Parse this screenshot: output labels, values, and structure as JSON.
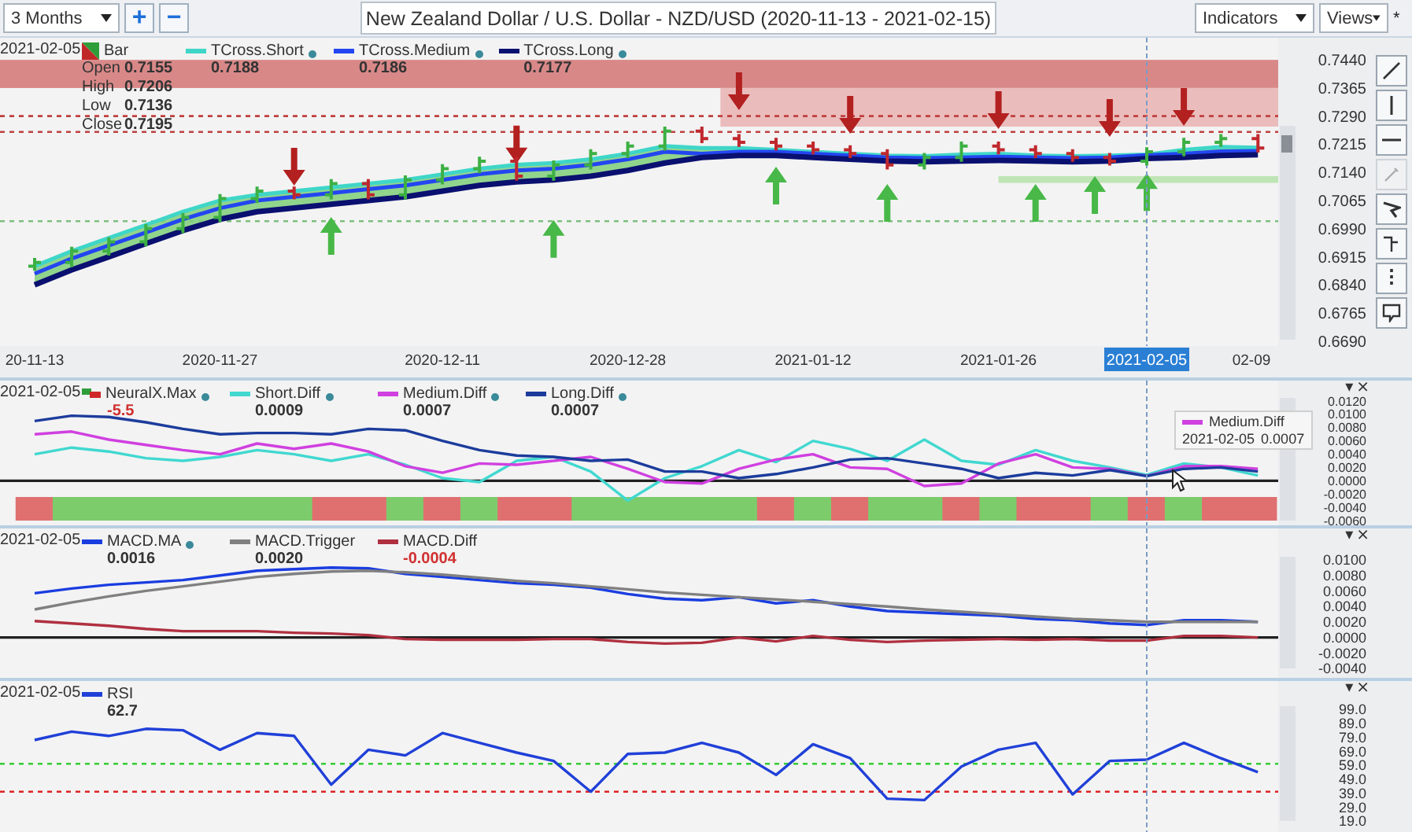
{
  "toolbar": {
    "period": "3 Months",
    "zoom_in": "+",
    "zoom_out": "−",
    "title": "New Zealand Dollar / U.S. Dollar - NZD/USD (2020-11-13 - 2021-02-15)",
    "indicators": "Indicators",
    "views": "Views",
    "modified": "*"
  },
  "tools": [
    {
      "kind": "trend-line",
      "disabled": false
    },
    {
      "kind": "vertical-line",
      "disabled": false
    },
    {
      "kind": "horizontal-line",
      "disabled": false
    },
    {
      "kind": "pencil",
      "disabled": true
    },
    {
      "kind": "marker",
      "disabled": false
    },
    {
      "kind": "fork",
      "disabled": false
    },
    {
      "kind": "dotted-line",
      "disabled": false
    },
    {
      "kind": "callout",
      "disabled": false
    }
  ],
  "panels": [
    {
      "kind": "price",
      "legend": {
        "date": "2021-02-05",
        "items": [
          {
            "kind": "bar",
            "label": "Bar",
            "ohlc": [
              {
                "label": "Open",
                "value": "0.7155"
              },
              {
                "label": "High",
                "value": "0.7206"
              },
              {
                "label": "Low",
                "value": "0.7136"
              },
              {
                "label": "Close",
                "value": "0.7195"
              }
            ]
          },
          {
            "kind": "line",
            "value": "0.7188",
            "dot": true,
            "negative": false
          },
          {
            "kind": "line",
            "value": "0.7186",
            "dot": true,
            "negative": false
          },
          {
            "kind": "line",
            "value": "0.7177",
            "dot": true,
            "negative": false
          }
        ]
      },
      "chart_data": {
        "type": "line",
        "categories": [
          "20-11-13",
          null,
          null,
          null,
          null,
          "2020-11-27",
          null,
          null,
          null,
          null,
          null,
          "2020-12-11",
          null,
          null,
          null,
          null,
          "2020-12-28",
          null,
          null,
          null,
          null,
          "2021-01-12",
          null,
          null,
          null,
          null,
          "2021-01-26",
          null,
          null,
          null,
          "2021-02-05",
          null,
          null,
          "02-09"
        ],
        "ylim": [
          0.6677,
          0.7499
        ],
        "yticks": [
          {
            "value": 0.744,
            "label": "0.7440"
          },
          {
            "value": 0.7365,
            "label": "0.7365"
          },
          {
            "value": 0.729,
            "label": "0.7290"
          },
          {
            "value": 0.7215,
            "label": "0.7215"
          },
          {
            "value": 0.714,
            "label": "0.7140"
          },
          {
            "value": 0.7065,
            "label": "0.7065"
          },
          {
            "value": 0.699,
            "label": "0.6990"
          },
          {
            "value": 0.6915,
            "label": "0.6915"
          },
          {
            "value": 0.684,
            "label": "0.6840"
          },
          {
            "value": 0.6765,
            "label": "0.6765"
          },
          {
            "value": 0.669,
            "label": "0.6690"
          }
        ],
        "series": [
          {
            "name": "TCross.Short",
            "color": "#3fd6c8",
            "values": [
              0.689,
              0.693,
              0.6965,
              0.7,
              0.7035,
              0.7065,
              0.708,
              0.709,
              0.71,
              0.711,
              0.712,
              0.7135,
              0.715,
              0.716,
              0.7165,
              0.7175,
              0.719,
              0.721,
              0.7205,
              0.7205,
              0.72,
              0.7195,
              0.719,
              0.7185,
              0.7183,
              0.7188,
              0.719,
              0.7185,
              0.7183,
              0.7185,
              0.7188,
              0.72,
              0.7208,
              0.7206
            ]
          },
          {
            "name": "TCross.Medium",
            "color": "#2346f0",
            "values": [
              0.687,
              0.691,
              0.6945,
              0.698,
              0.7015,
              0.7045,
              0.7065,
              0.7075,
              0.7085,
              0.7095,
              0.7105,
              0.712,
              0.7135,
              0.7145,
              0.715,
              0.716,
              0.7175,
              0.7195,
              0.719,
              0.7195,
              0.7195,
              0.719,
              0.7185,
              0.718,
              0.7178,
              0.718,
              0.7182,
              0.718,
              0.7178,
              0.718,
              0.7186,
              0.719,
              0.7196,
              0.7197
            ]
          },
          {
            "name": "TCross.Long",
            "color": "#0a1070",
            "values": [
              0.684,
              0.688,
              0.6915,
              0.695,
              0.6985,
              0.7015,
              0.7035,
              0.7045,
              0.7055,
              0.7065,
              0.7075,
              0.709,
              0.7105,
              0.7115,
              0.712,
              0.713,
              0.7145,
              0.7165,
              0.718,
              0.7185,
              0.7185,
              0.718,
              0.7175,
              0.717,
              0.7168,
              0.717,
              0.7172,
              0.717,
              0.7168,
              0.717,
              0.7177,
              0.718,
              0.7185,
              0.7187
            ]
          }
        ],
        "bands": [
          {
            "axis": "y",
            "from": 0.7365,
            "to": 0.744,
            "color": "#d98888"
          },
          {
            "axis": "y",
            "from": 0.7262,
            "to": 0.7365,
            "color": "#ebbcbc"
          },
          {
            "axis": "y",
            "from": 0.7112,
            "to": 0.713,
            "color": "#bfe4b5"
          }
        ],
        "ref_lines": [
          {
            "axis": "y",
            "value": 0.729,
            "color": "#c04040"
          },
          {
            "axis": "y",
            "value": 0.7248,
            "color": "#c04040"
          },
          {
            "axis": "y",
            "value": 0.701,
            "color": "#7fbf7f"
          }
        ]
      }
    },
    {
      "kind": "neural",
      "controls": [
        "▾",
        "×"
      ],
      "legend": {
        "date": "2021-02-05",
        "items": [
          {
            "kind": "signal",
            "label": "NeuralX.Max",
            "value": "-5.5",
            "dot": true,
            "negative": true
          },
          {
            "kind": "line",
            "value": "0.0009",
            "dot": true,
            "negative": false
          },
          {
            "kind": "line",
            "value": "0.0007",
            "dot": true,
            "negative": false
          },
          {
            "kind": "line",
            "value": "0.0007",
            "dot": true,
            "negative": false
          }
        ]
      },
      "tooltip": {
        "series": "Medium.Diff",
        "color": "#d040e0",
        "date": "2021-02-05",
        "value": "0.0007"
      },
      "chart_data": {
        "type": "line",
        "ylim": [
          -0.006,
          0.012
        ],
        "yticks": [
          {
            "value": 0.012,
            "label": "0.0120"
          },
          {
            "value": 0.01,
            "label": "0.0100"
          },
          {
            "value": 0.008,
            "label": "0.0080"
          },
          {
            "value": 0.006,
            "label": "0.0060"
          },
          {
            "value": 0.004,
            "label": "0.0040"
          },
          {
            "value": 0.002,
            "label": "0.0020"
          },
          {
            "value": 0,
            "label": "0.0000"
          },
          {
            "value": -0.002,
            "label": "-0.0020"
          },
          {
            "value": -0.004,
            "label": "-0.0040"
          },
          {
            "value": -0.006,
            "label": "-0.0060"
          }
        ],
        "series": [
          {
            "name": "Short.Diff",
            "color": "#40d8d0",
            "values": [
              0.004,
              0.005,
              0.0044,
              0.0034,
              0.003,
              0.0036,
              0.0046,
              0.004,
              0.003,
              0.004,
              0.0024,
              0.0004,
              -0.0002,
              0.003,
              0.0036,
              0.0014,
              -0.003,
              0.0004,
              0.0022,
              0.0046,
              0.0028,
              0.006,
              0.0048,
              0.003,
              0.0062,
              0.003,
              0.0024,
              0.0046,
              0.003,
              0.002,
              0.0009,
              0.0026,
              0.002,
              0.0008
            ]
          },
          {
            "name": "Medium.Diff",
            "color": "#d040e0",
            "values": [
              0.007,
              0.0074,
              0.0062,
              0.0054,
              0.0046,
              0.004,
              0.0056,
              0.0048,
              0.0056,
              0.0044,
              0.0022,
              0.0012,
              0.0026,
              0.0024,
              0.003,
              0.0036,
              0.0018,
              -0.0002,
              -0.0004,
              0.0018,
              0.0032,
              0.004,
              0.002,
              0.0018,
              -0.0008,
              -0.0004,
              0.0026,
              0.004,
              0.002,
              0.0018,
              0.0007,
              0.0022,
              0.0022,
              0.0018
            ]
          },
          {
            "name": "Long.Diff",
            "color": "#1c3c9c",
            "values": [
              0.009,
              0.0098,
              0.0096,
              0.0088,
              0.0078,
              0.007,
              0.0072,
              0.0072,
              0.007,
              0.0078,
              0.0076,
              0.006,
              0.0046,
              0.0038,
              0.0036,
              0.003,
              0.0032,
              0.0014,
              0.0014,
              0.0004,
              0.001,
              0.002,
              0.0032,
              0.0034,
              0.0026,
              0.0018,
              0.0004,
              0.0012,
              0.0008,
              0.0016,
              0.0007,
              0.0018,
              0.002,
              0.0014
            ]
          }
        ],
        "ref_lines": [
          {
            "axis": "y",
            "value": 0,
            "color": "#202020"
          }
        ]
      }
    },
    {
      "kind": "macd",
      "controls": [
        "▾",
        "×"
      ],
      "legend": {
        "date": "2021-02-05",
        "items": [
          {
            "kind": "line",
            "value": "0.0016",
            "dot": true,
            "negative": false
          },
          {
            "kind": "line",
            "value": "0.0020",
            "dot": false,
            "negative": false
          },
          {
            "kind": "line",
            "value": "-0.0004",
            "dot": false,
            "negative": true
          }
        ]
      },
      "chart_data": {
        "type": "line",
        "ylim": [
          -0.004,
          0.01
        ],
        "yticks": [
          {
            "value": 0.01,
            "label": "0.0100"
          },
          {
            "value": 0.008,
            "label": "0.0080"
          },
          {
            "value": 0.006,
            "label": "0.0060"
          },
          {
            "value": 0.004,
            "label": "0.0040"
          },
          {
            "value": 0.002,
            "label": "0.0020"
          },
          {
            "value": 0,
            "label": "0.0000"
          },
          {
            "value": -0.002,
            "label": "-0.0020"
          },
          {
            "value": -0.004,
            "label": "-0.0040"
          }
        ],
        "series": [
          {
            "name": "MACD.MA",
            "color": "#1a3de0",
            "values": [
              0.0057,
              0.0063,
              0.0068,
              0.0071,
              0.0074,
              0.008,
              0.0086,
              0.0088,
              0.009,
              0.0089,
              0.0082,
              0.0078,
              0.0074,
              0.007,
              0.0068,
              0.0064,
              0.0056,
              0.005,
              0.0048,
              0.0052,
              0.0044,
              0.0048,
              0.004,
              0.0034,
              0.0032,
              0.003,
              0.0028,
              0.0024,
              0.0022,
              0.0018,
              0.0016,
              0.0022,
              0.0022,
              0.002
            ]
          },
          {
            "name": "MACD.Trigger",
            "color": "#808080",
            "values": [
              0.0036,
              0.0045,
              0.0053,
              0.006,
              0.0066,
              0.0072,
              0.0078,
              0.0082,
              0.0085,
              0.0086,
              0.0084,
              0.0081,
              0.0077,
              0.0073,
              0.007,
              0.0066,
              0.0062,
              0.0058,
              0.0055,
              0.0052,
              0.0049,
              0.0046,
              0.0043,
              0.004,
              0.0036,
              0.0033,
              0.003,
              0.0027,
              0.0024,
              0.0022,
              0.002,
              0.002,
              0.002,
              0.002
            ]
          },
          {
            "name": "MACD.Diff",
            "color": "#b03040",
            "values": [
              0.0021,
              0.0018,
              0.0015,
              0.0011,
              0.0008,
              0.0008,
              0.0008,
              0.0006,
              0.0005,
              0.0003,
              -0.0002,
              -0.0003,
              -0.0003,
              -0.0003,
              -0.0002,
              -0.0002,
              -0.0006,
              -0.0008,
              -0.0007,
              0.0,
              -0.0005,
              0.0002,
              -0.0003,
              -0.0006,
              -0.0004,
              -0.0003,
              -0.0002,
              -0.0003,
              -0.0002,
              -0.0004,
              -0.0004,
              0.0002,
              0.0002,
              0.0
            ]
          }
        ],
        "ref_lines": [
          {
            "axis": "y",
            "value": 0,
            "color": "#202020"
          }
        ]
      }
    },
    {
      "kind": "rsi",
      "controls": [
        "▾",
        "×"
      ],
      "legend": {
        "date": "2021-02-05",
        "items": [
          {
            "kind": "line",
            "value": "62.7",
            "dot": false,
            "negative": false
          }
        ]
      },
      "chart_data": {
        "type": "line",
        "ylim": [
          19,
          99
        ],
        "yticks": [
          {
            "value": 99,
            "label": "99.0"
          },
          {
            "value": 89,
            "label": "89.0"
          },
          {
            "value": 79,
            "label": "79.0"
          },
          {
            "value": 69,
            "label": "69.0"
          },
          {
            "value": 59,
            "label": "59.0"
          },
          {
            "value": 49,
            "label": "49.0"
          },
          {
            "value": 39,
            "label": "39.0"
          },
          {
            "value": 29,
            "label": "29.0"
          },
          {
            "value": 19,
            "label": "19.0"
          }
        ],
        "series": [
          {
            "name": "RSI",
            "color": "#2040d8",
            "values": [
              77,
              83,
              80,
              85,
              84,
              70,
              82,
              80,
              45,
              70,
              66,
              82,
              75,
              68,
              62,
              40,
              67,
              68,
              75,
              68,
              52,
              74,
              64,
              35,
              34,
              58,
              70,
              75,
              38,
              62,
              63,
              75,
              64,
              54
            ]
          }
        ],
        "ref_lines": [
          {
            "axis": "y",
            "value": 60,
            "color": "#33cc33"
          },
          {
            "axis": "y",
            "value": 40,
            "color": "#dd2222"
          }
        ]
      }
    }
  ]
}
